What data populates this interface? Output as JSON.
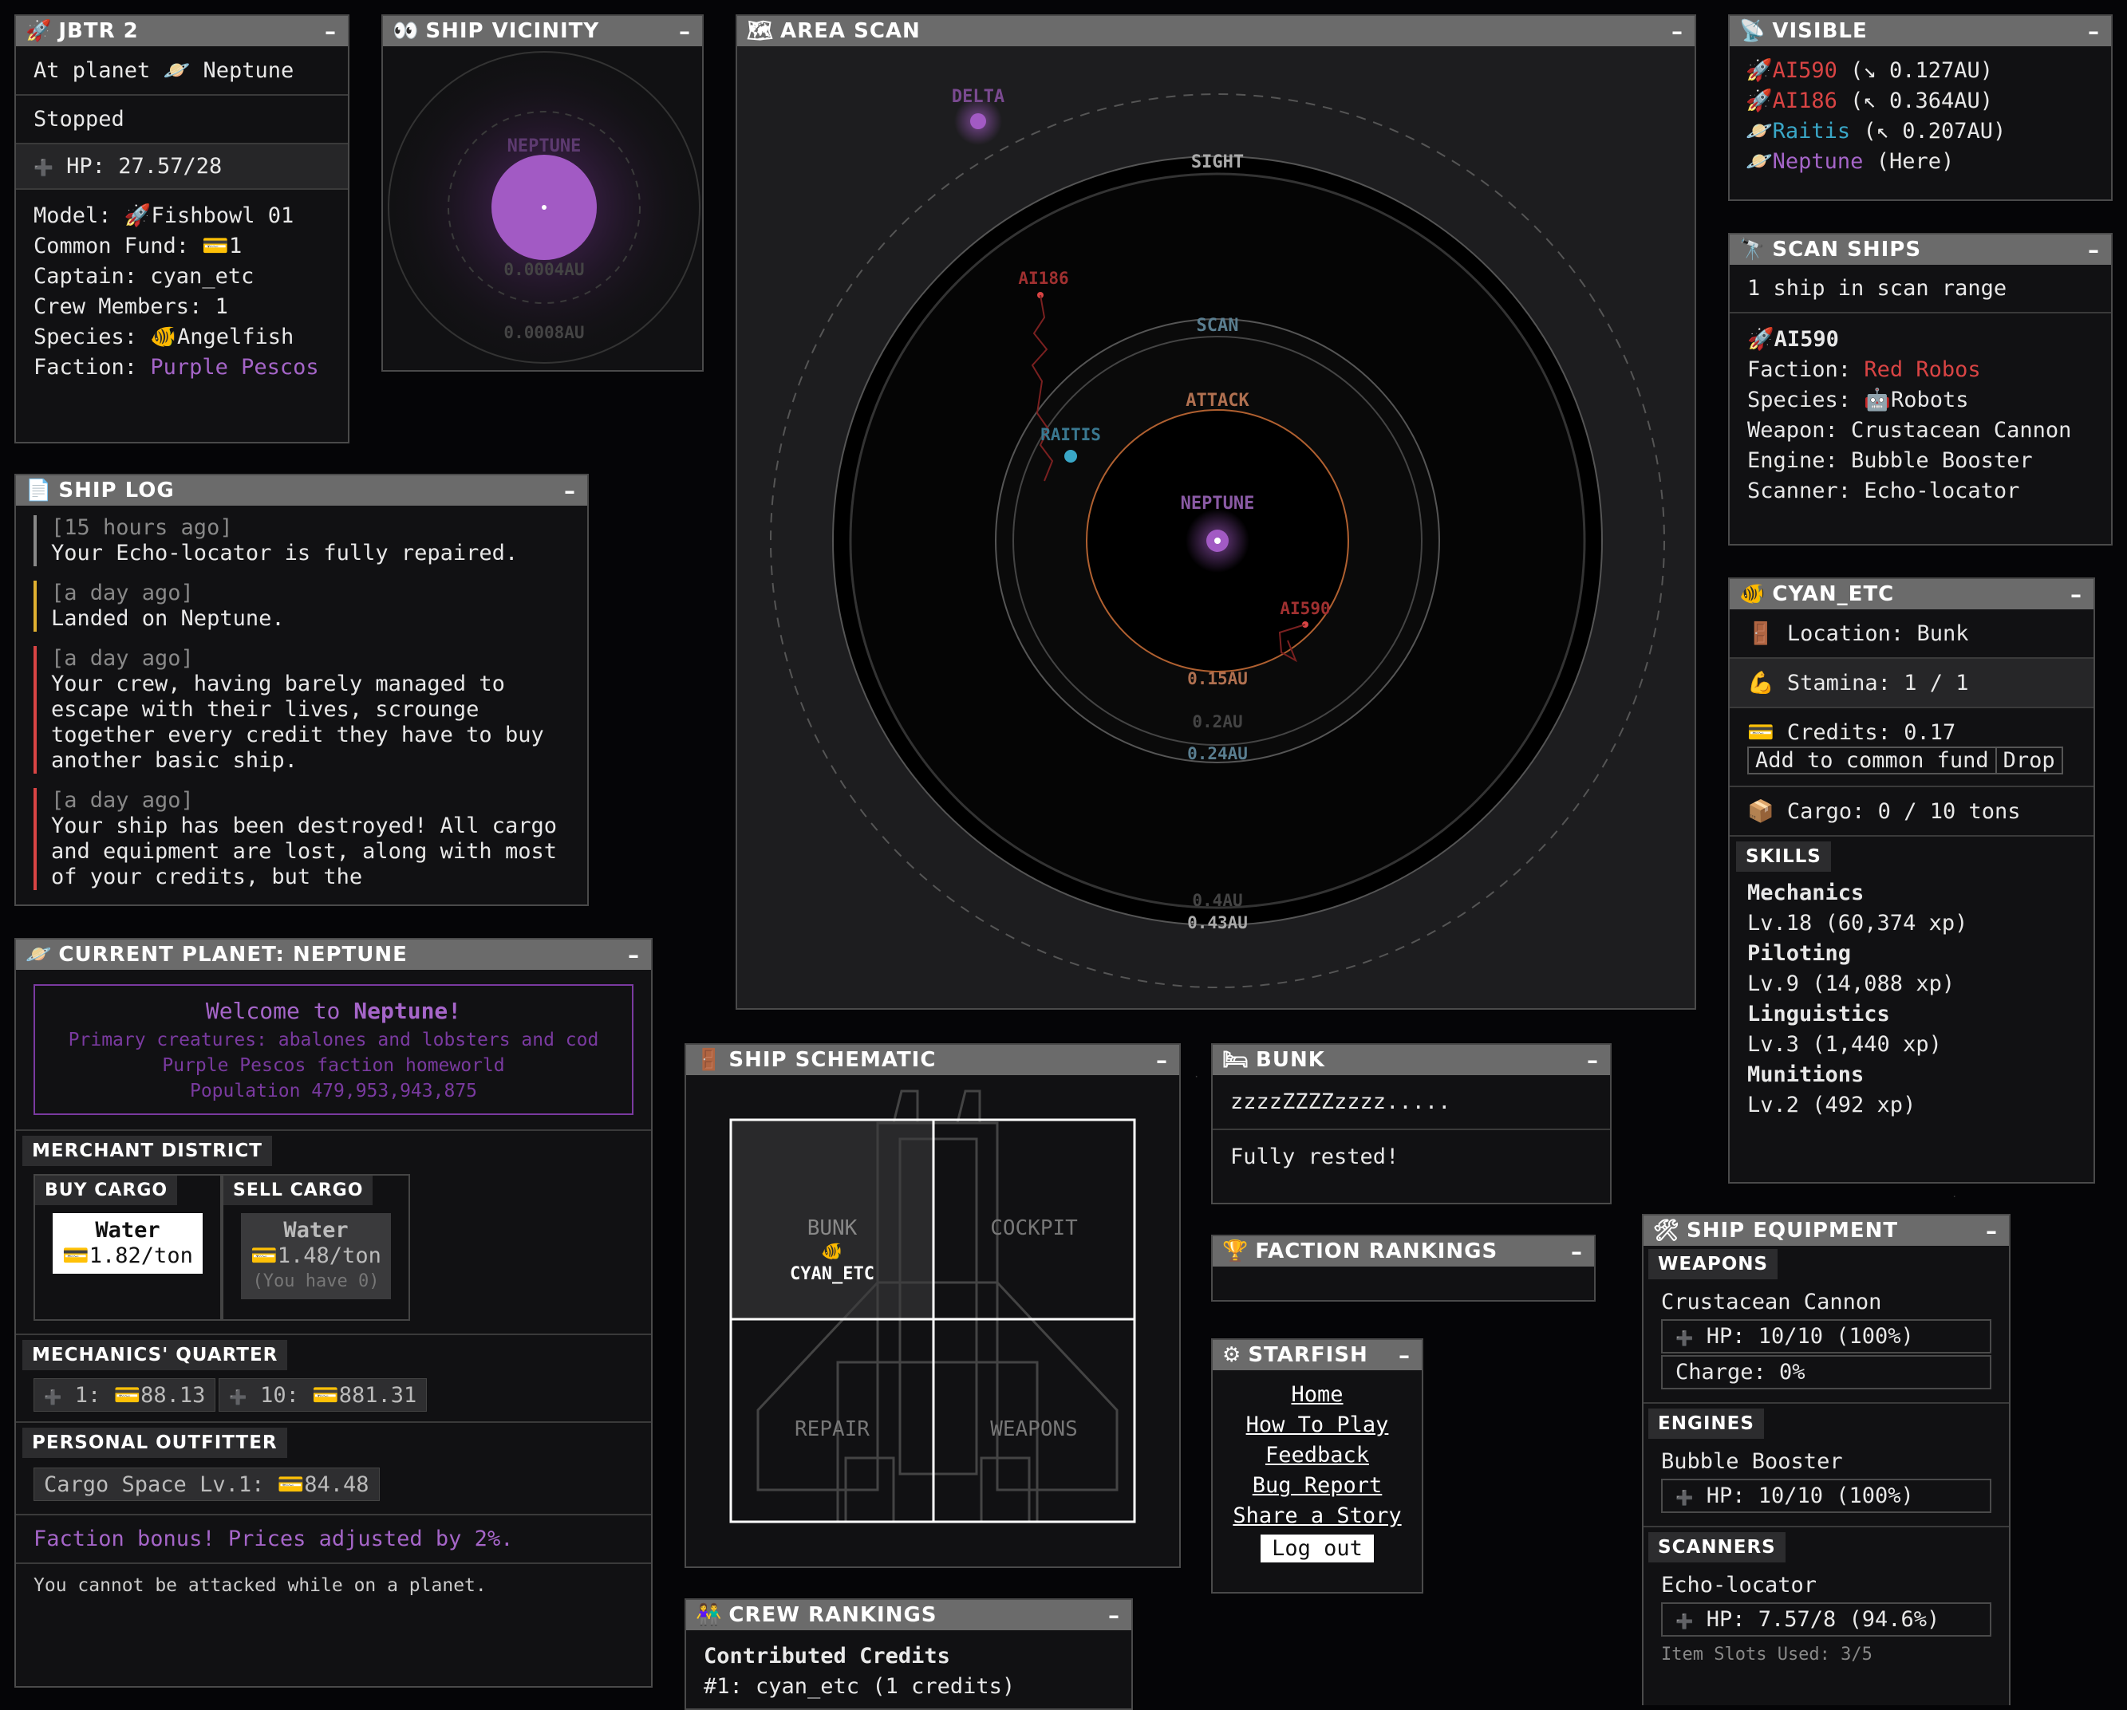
{
  "ship_panel": {
    "title": "JBTR 2",
    "location_prefix": "At planet",
    "location_planet": "Neptune",
    "status": "Stopped",
    "hp": "HP: 27.57/28",
    "model_label": "Model:",
    "model": "Fishbowl 01",
    "fund_label": "Common Fund:",
    "fund": "1",
    "captain": "Captain: cyan_etc",
    "crew": "Crew Members: 1",
    "species_label": "Species:",
    "species": "Angelfish",
    "faction_label": "Faction:",
    "faction": "Purple Pescos"
  },
  "vicinity": {
    "title": "SHIP VICINITY",
    "planet": "NEPTUNE",
    "ring1": "0.0004AU",
    "ring2": "0.0008AU"
  },
  "area_scan": {
    "title": "AREA SCAN",
    "labels": {
      "delta": "DELTA",
      "sight": "SIGHT",
      "scan": "SCAN",
      "attack": "ATTACK",
      "neptune": "NEPTUNE",
      "ai186": "AI186",
      "raitis": "RAITIS",
      "ai590": "AI590",
      "r015": "0.15AU",
      "r02": "0.2AU",
      "r024": "0.24AU",
      "r04": "0.4AU",
      "r043": "0.43AU"
    }
  },
  "visible": {
    "title": "VISIBLE",
    "items": [
      {
        "name": "AI590",
        "detail": "(↘ 0.127AU)"
      },
      {
        "name": "AI186",
        "detail": "(↖ 0.364AU)"
      },
      {
        "name": "Raitis",
        "detail": "(↖ 0.207AU)"
      },
      {
        "name": "Neptune",
        "detail": "(Here)"
      }
    ]
  },
  "scan_ships": {
    "title": "SCAN SHIPS",
    "count": "1 ship in scan range",
    "ship_name": "AI590",
    "faction_label": "Faction:",
    "faction": "Red Robos",
    "species_label": "Species:",
    "species": "Robots",
    "weapon": "Weapon: Crustacean Cannon",
    "engine": "Engine: Bubble Booster",
    "scanner": "Scanner: Echo-locator"
  },
  "crew_member": {
    "title": "CYAN_ETC",
    "location": "Location: Bunk",
    "stamina": "Stamina: 1 / 1",
    "credits": "Credits: 0.17",
    "add_fund_button": "Add to common fund",
    "drop_button": "Drop",
    "cargo": "Cargo: 0 / 10 tons",
    "skills_header": "SKILLS",
    "skills": [
      {
        "name": "Mechanics",
        "level": "Lv.18 (60,374 xp)"
      },
      {
        "name": "Piloting",
        "level": "Lv.9 (14,088 xp)"
      },
      {
        "name": "Linguistics",
        "level": "Lv.3 (1,440 xp)"
      },
      {
        "name": "Munitions",
        "level": "Lv.2 (492 xp)"
      }
    ]
  },
  "ship_log": {
    "title": "SHIP LOG",
    "entries": [
      {
        "time": "[15 hours ago]",
        "text": "Your Echo-locator is fully repaired.",
        "color": "#888888"
      },
      {
        "time": "[a day ago]",
        "text": "Landed on Neptune.",
        "color": "#e0b030"
      },
      {
        "time": "[a day ago]",
        "text": "Your crew, having barely managed to escape with their lives, scrounge together every credit they have to buy another basic ship.",
        "color": "#d94444"
      },
      {
        "time": "[a day ago]",
        "text": "Your ship has been destroyed! All cargo and equipment are lost, along with most of your credits, but the",
        "color": "#d94444"
      }
    ]
  },
  "planet": {
    "title": "CURRENT PLANET: NEPTUNE",
    "welcome_prefix": "Welcome to",
    "welcome_name": "Neptune!",
    "creatures": "Primary creatures: abalones and lobsters and cod",
    "homeworld": "Purple Pescos faction homeworld",
    "population": "Population 479,953,943,875",
    "merchant_header": "MERCHANT DISTRICT",
    "buy_header": "BUY CARGO",
    "sell_header": "SELL CARGO",
    "buy_item": "Water",
    "buy_price": "1.82/ton",
    "sell_item": "Water",
    "sell_price": "1.48/ton",
    "sell_have": "(You have 0)",
    "mechanics_header": "MECHANICS' QUARTER",
    "repair1": "1:",
    "repair1_price": "88.13",
    "repair10": "10:",
    "repair10_price": "881.31",
    "outfitter_header": "PERSONAL OUTFITTER",
    "outfit_item": "Cargo Space Lv.1:",
    "outfit_price": "84.48",
    "faction_bonus": "Faction bonus! Prices adjusted by 2%.",
    "safe_notice": "You cannot be attacked while on a planet."
  },
  "schematic": {
    "title": "SHIP SCHEMATIC",
    "rooms": [
      "BUNK",
      "COCKPIT",
      "REPAIR",
      "WEAPONS"
    ],
    "occupant": "CYAN_ETC"
  },
  "crew_rankings": {
    "title": "CREW RANKINGS",
    "subtitle": "Contributed Credits",
    "row1": "#1: cyan_etc (1 credits)"
  },
  "bunk": {
    "title": "BUNK",
    "sleep": "zzzzZZZZzzzz.....",
    "status": "Fully rested!"
  },
  "faction_rankings": {
    "title": "FACTION RANKINGS"
  },
  "starfish": {
    "title": "STARFISH",
    "links": [
      "Home",
      "How To Play",
      "Feedback",
      "Bug Report",
      "Share a Story"
    ],
    "logout": "Log out"
  },
  "equipment": {
    "title": "SHIP EQUIPMENT",
    "weapons_header": "WEAPONS",
    "weapon_name": "Crustacean Cannon",
    "weapon_hp": "HP: 10/10 (100%)",
    "weapon_charge": "Charge: 0%",
    "engines_header": "ENGINES",
    "engine_name": "Bubble Booster",
    "engine_hp": "HP: 10/10 (100%)",
    "scanners_header": "SCANNERS",
    "scanner_name": "Echo-locator",
    "scanner_hp": "HP: 7.57/8 (94.6%)",
    "slots": "Item Slots Used: 3/5"
  },
  "minimize": "–"
}
